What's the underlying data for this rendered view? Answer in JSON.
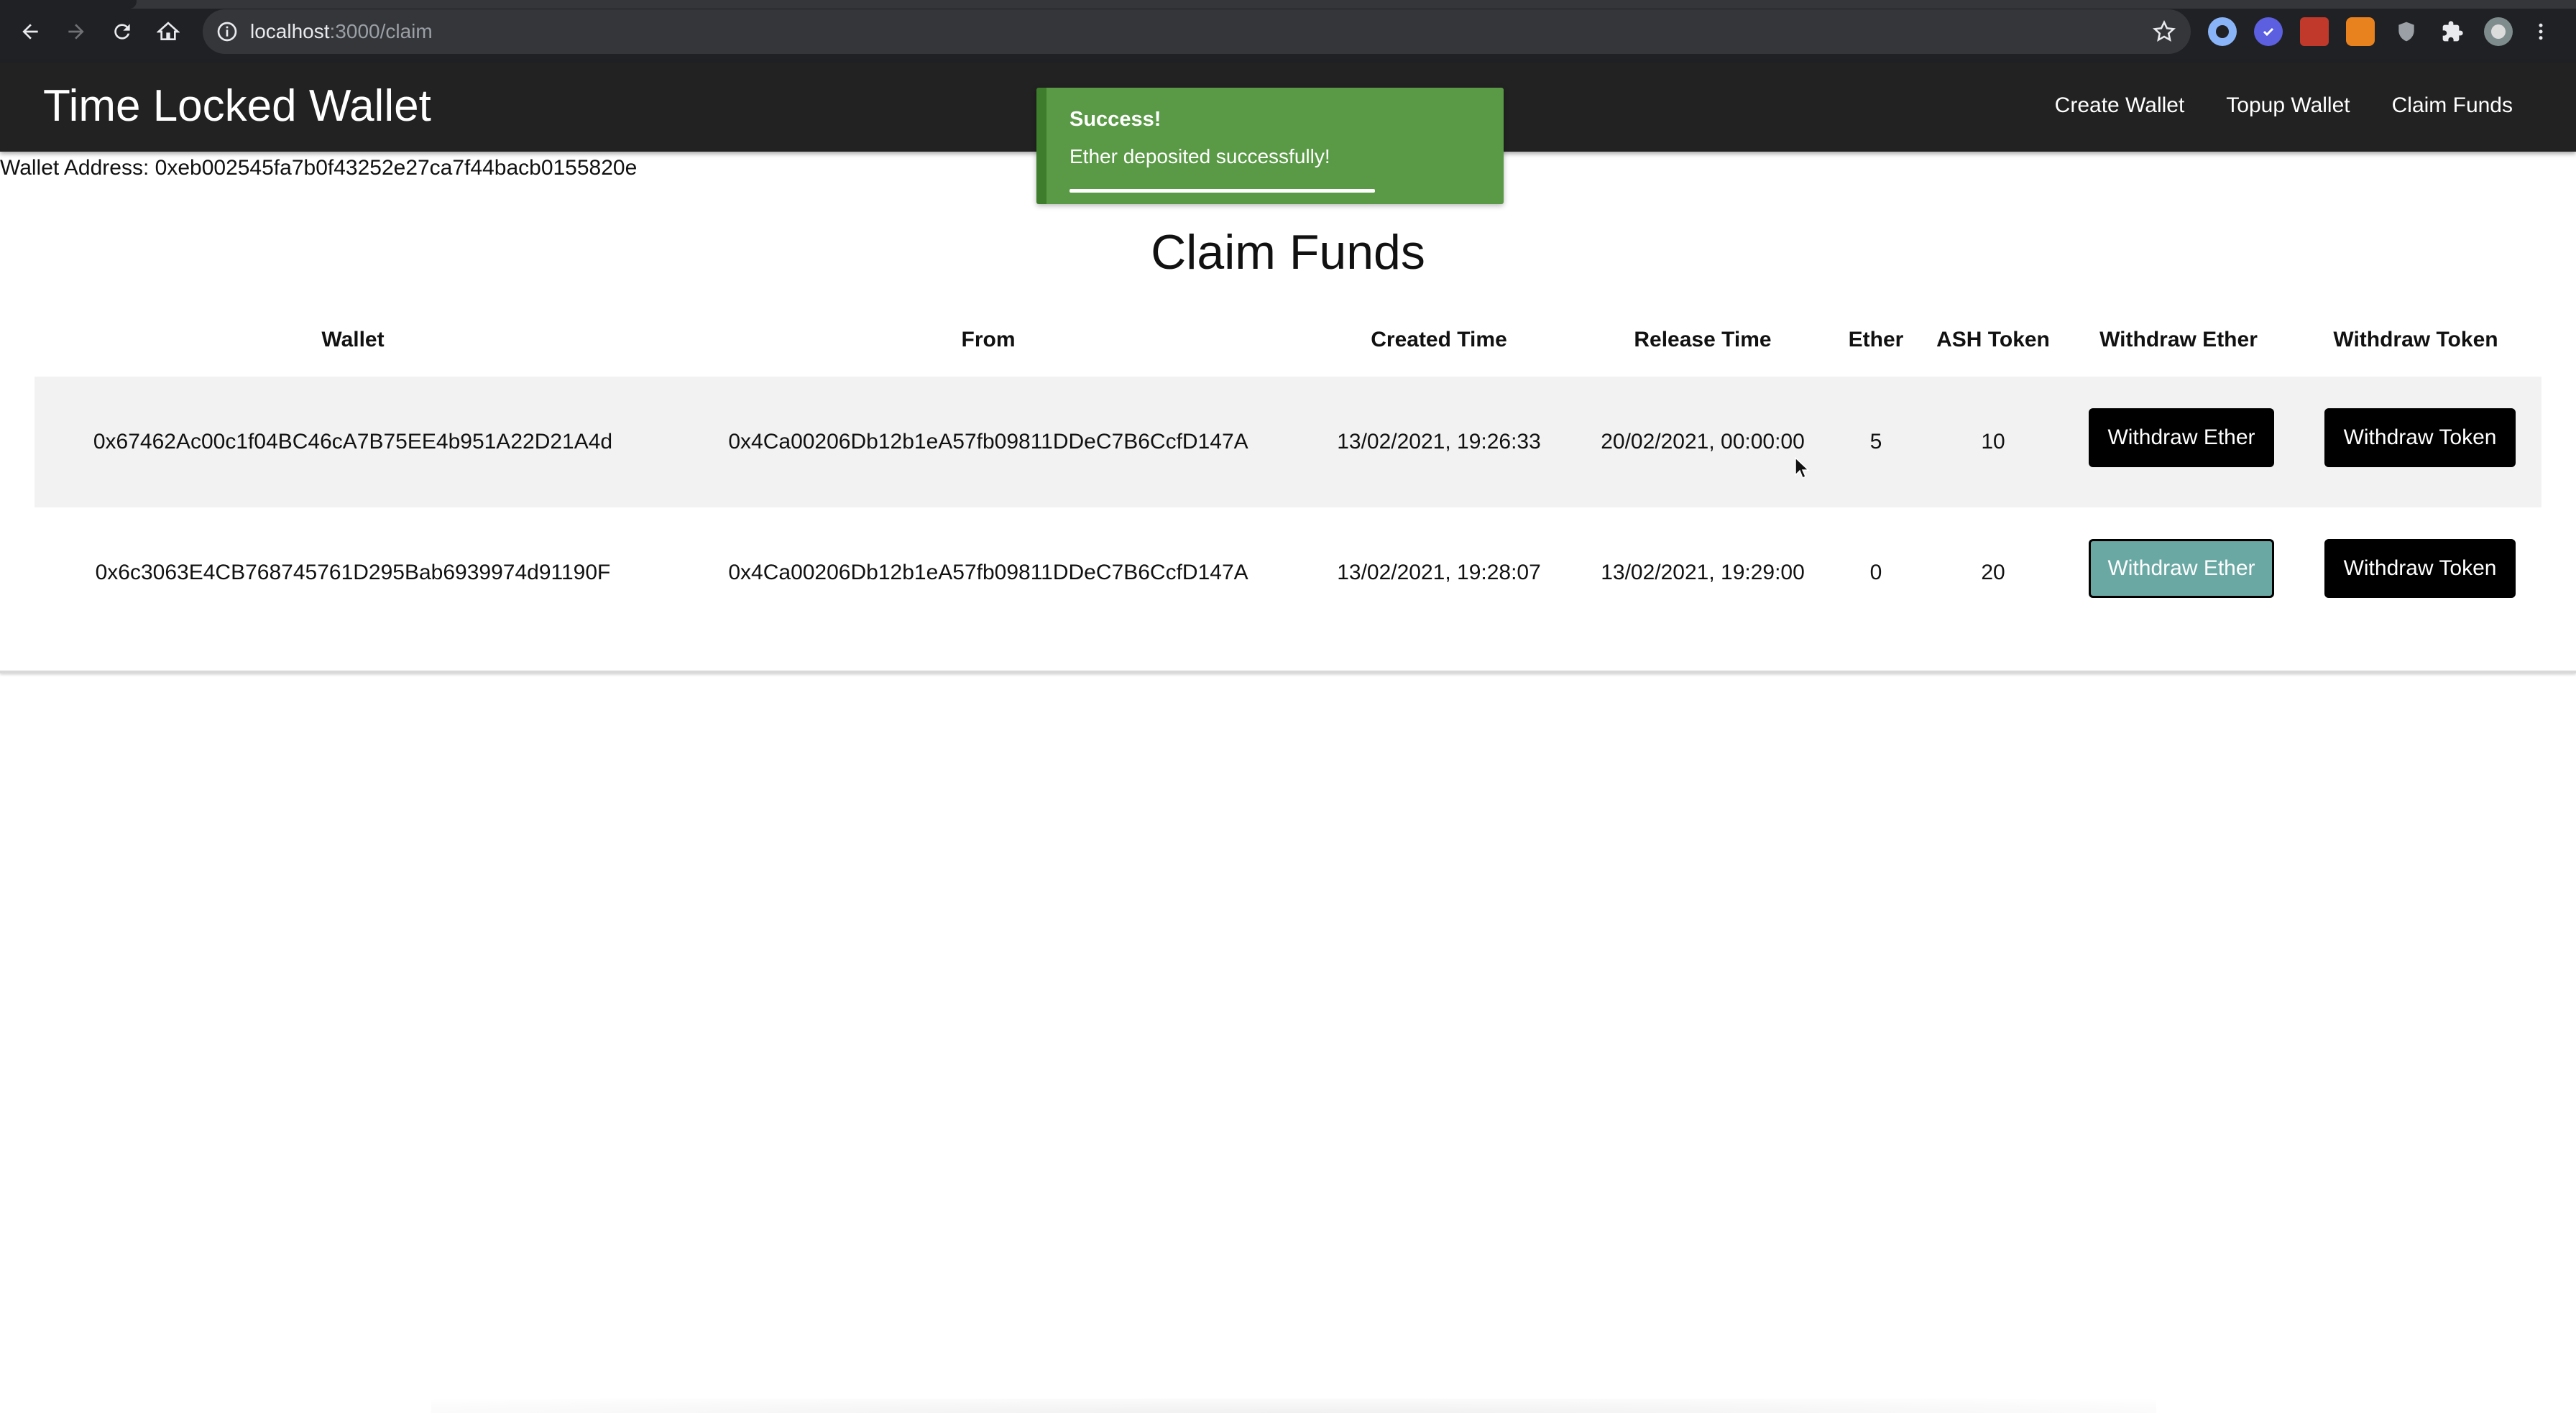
{
  "browser": {
    "url_host": "localhost",
    "url_path": ":3000/claim"
  },
  "navbar": {
    "brand": "Time Locked Wallet",
    "links": [
      "Create Wallet",
      "Topup Wallet",
      "Claim Funds"
    ]
  },
  "wallet_address": "Wallet Address: 0xeb002545fa7b0f43252e27ca7f44bacb0155820e",
  "toast": {
    "title": "Success!",
    "message": "Ether deposited successfully!",
    "progress": 0.72,
    "color": "#5a9a46"
  },
  "page_title": "Claim Funds",
  "table": {
    "headers": [
      "Wallet",
      "From",
      "Created Time",
      "Release Time",
      "Ether",
      "ASH Token",
      "Withdraw Ether",
      "Withdraw Token"
    ],
    "rows": [
      {
        "wallet": "0x67462Ac00c1f04BC46cA7B75EE4b951A22D21A4d",
        "from": "0x4Ca00206Db12b1eA57fb09811DDeC7B6CcfD147A",
        "created": "13/02/2021, 19:26:33",
        "release": "20/02/2021, 00:00:00",
        "ether": "5",
        "ash": "10",
        "withdraw_ether": "Withdraw Ether",
        "withdraw_token": "Withdraw Token"
      },
      {
        "wallet": "0x6c3063E4CB768745761D295Bab6939974d91190F",
        "from": "0x4Ca00206Db12b1eA57fb09811DDeC7B6CcfD147A",
        "created": "13/02/2021, 19:28:07",
        "release": "13/02/2021, 19:29:00",
        "ether": "0",
        "ash": "20",
        "withdraw_ether": "Withdraw Ether",
        "withdraw_token": "Withdraw Token"
      }
    ]
  },
  "colors": {
    "navbar": "#222222",
    "toast_success": "#5a9a46",
    "button_primary": "#000000",
    "button_teal": "#6aa8a4",
    "row_stripe": "#f2f2f2"
  }
}
